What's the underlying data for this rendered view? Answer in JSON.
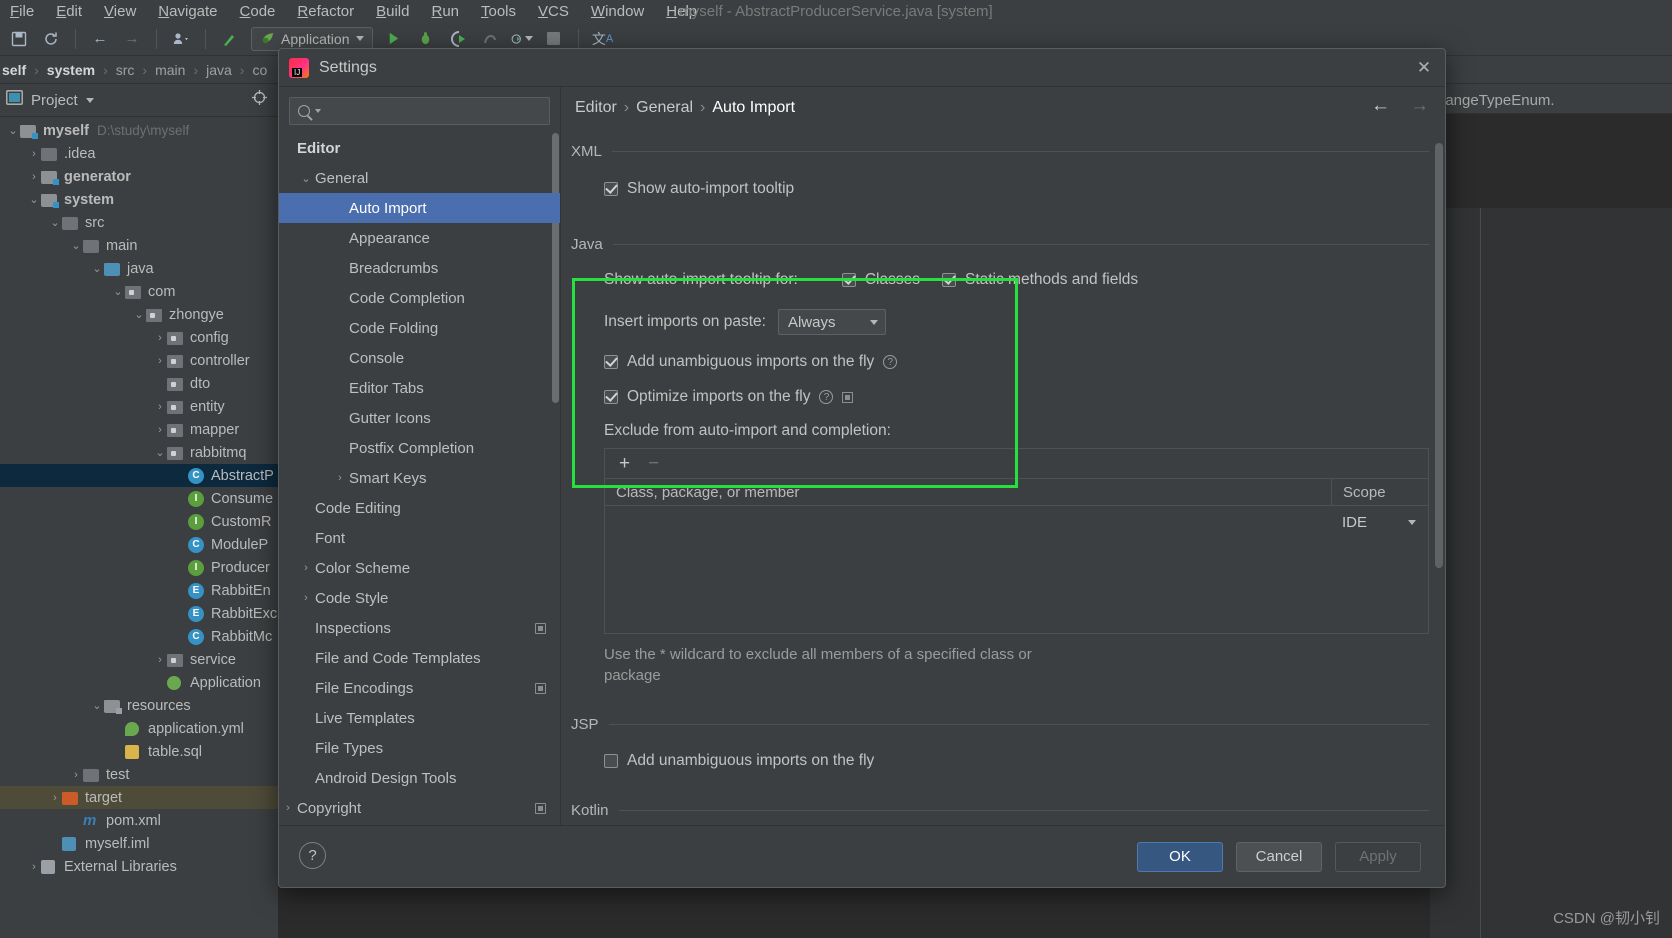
{
  "ide": {
    "window_title": "myself - AbstractProducerService.java [system]",
    "menubar": [
      "File",
      "Edit",
      "View",
      "Navigate",
      "Code",
      "Refactor",
      "Build",
      "Run",
      "Tools",
      "VCS",
      "Window",
      "Help"
    ],
    "toolbar": {
      "run_config": "Application",
      "icons": [
        "save-icon",
        "sync-icon",
        "back-arrow-icon",
        "forward-arrow-icon",
        "profile-icon",
        "build-icon",
        "run-icon",
        "debug-icon",
        "run-coverage-icon",
        "profiler-icon",
        "stop-icon",
        "translate-icon"
      ]
    },
    "breadcrumb": [
      "self",
      "system",
      "src",
      "main",
      "java",
      "co"
    ],
    "editor_tab": "hangeTypeEnum."
  },
  "project_panel": {
    "title": "Project",
    "tree": [
      {
        "indent": 0,
        "arrow": "down",
        "icon": "module-folder",
        "label": "myself",
        "bold": true,
        "path": "D:\\study\\myself"
      },
      {
        "indent": 1,
        "arrow": "right",
        "icon": "folder",
        "label": ".idea",
        "bold": false
      },
      {
        "indent": 1,
        "arrow": "right",
        "icon": "module-folder",
        "label": "generator",
        "bold": true
      },
      {
        "indent": 1,
        "arrow": "down",
        "icon": "module-folder",
        "label": "system",
        "bold": true
      },
      {
        "indent": 2,
        "arrow": "down",
        "icon": "folder",
        "label": "src",
        "bold": false
      },
      {
        "indent": 3,
        "arrow": "down",
        "icon": "folder",
        "label": "main",
        "bold": false
      },
      {
        "indent": 4,
        "arrow": "down",
        "icon": "source-folder",
        "label": "java",
        "bold": false
      },
      {
        "indent": 5,
        "arrow": "down",
        "icon": "package",
        "label": "com",
        "bold": false
      },
      {
        "indent": 6,
        "arrow": "down",
        "icon": "package",
        "label": "zhongye",
        "bold": false
      },
      {
        "indent": 7,
        "arrow": "right",
        "icon": "package",
        "label": "config",
        "bold": false
      },
      {
        "indent": 7,
        "arrow": "right",
        "icon": "package",
        "label": "controller",
        "bold": false
      },
      {
        "indent": 7,
        "arrow": "none",
        "icon": "package",
        "label": "dto",
        "bold": false
      },
      {
        "indent": 7,
        "arrow": "right",
        "icon": "package",
        "label": "entity",
        "bold": false
      },
      {
        "indent": 7,
        "arrow": "right",
        "icon": "package",
        "label": "mapper",
        "bold": false
      },
      {
        "indent": 7,
        "arrow": "down",
        "icon": "package",
        "label": "rabbitmq",
        "bold": false
      },
      {
        "indent": 8,
        "arrow": "none",
        "icon": "class",
        "label": "AbstractP",
        "bold": false,
        "selected": true
      },
      {
        "indent": 8,
        "arrow": "none",
        "icon": "interface",
        "label": "Consume",
        "bold": false
      },
      {
        "indent": 8,
        "arrow": "none",
        "icon": "interface",
        "label": "CustomR",
        "bold": false
      },
      {
        "indent": 8,
        "arrow": "none",
        "icon": "class",
        "label": "ModuleP",
        "bold": false
      },
      {
        "indent": 8,
        "arrow": "none",
        "icon": "interface",
        "label": "Producer",
        "bold": false
      },
      {
        "indent": 8,
        "arrow": "none",
        "icon": "enum",
        "label": "RabbitEn",
        "bold": false
      },
      {
        "indent": 8,
        "arrow": "none",
        "icon": "enum",
        "label": "RabbitExc",
        "bold": false
      },
      {
        "indent": 8,
        "arrow": "none",
        "icon": "class",
        "label": "RabbitMc",
        "bold": false
      },
      {
        "indent": 7,
        "arrow": "right",
        "icon": "package",
        "label": "service",
        "bold": false
      },
      {
        "indent": 7,
        "arrow": "none",
        "icon": "spring",
        "label": "Application",
        "bold": false
      },
      {
        "indent": 4,
        "arrow": "down",
        "icon": "resource-folder",
        "label": "resources",
        "bold": false
      },
      {
        "indent": 5,
        "arrow": "none",
        "icon": "yml",
        "label": "application.yml",
        "bold": false
      },
      {
        "indent": 5,
        "arrow": "none",
        "icon": "sql",
        "label": "table.sql",
        "bold": false
      },
      {
        "indent": 3,
        "arrow": "right",
        "icon": "folder",
        "label": "test",
        "bold": false
      },
      {
        "indent": 2,
        "arrow": "right",
        "icon": "excluded-folder",
        "label": "target",
        "bold": false,
        "highlighted": true
      },
      {
        "indent": 3,
        "arrow": "none",
        "icon": "maven",
        "label": "pom.xml",
        "bold": false
      },
      {
        "indent": 2,
        "arrow": "none",
        "icon": "iml",
        "label": "myself.iml",
        "bold": false
      },
      {
        "indent": 1,
        "arrow": "right",
        "icon": "library",
        "label": "External Libraries",
        "bold": false
      }
    ]
  },
  "settings_dialog": {
    "title": "Settings",
    "close_icon": "close-icon",
    "search": {
      "placeholder": "",
      "value": "",
      "icon": "search-icon"
    },
    "nav": [
      {
        "label": "Editor",
        "level": 0,
        "twisty": "",
        "active": false
      },
      {
        "label": "General",
        "level": 1,
        "twisty": "down",
        "active": false
      },
      {
        "label": "Auto Import",
        "level": 2,
        "twisty": "",
        "active": true
      },
      {
        "label": "Appearance",
        "level": 2,
        "twisty": "",
        "active": false
      },
      {
        "label": "Breadcrumbs",
        "level": 2,
        "twisty": "",
        "active": false
      },
      {
        "label": "Code Completion",
        "level": 2,
        "twisty": "",
        "active": false
      },
      {
        "label": "Code Folding",
        "level": 2,
        "twisty": "",
        "active": false
      },
      {
        "label": "Console",
        "level": 2,
        "twisty": "",
        "active": false
      },
      {
        "label": "Editor Tabs",
        "level": 2,
        "twisty": "",
        "active": false
      },
      {
        "label": "Gutter Icons",
        "level": 2,
        "twisty": "",
        "active": false
      },
      {
        "label": "Postfix Completion",
        "level": 2,
        "twisty": "",
        "active": false
      },
      {
        "label": "Smart Keys",
        "level": 2,
        "twisty": "right",
        "active": false
      },
      {
        "label": "Code Editing",
        "level": 1,
        "twisty": "",
        "active": false
      },
      {
        "label": "Font",
        "level": 1,
        "twisty": "",
        "active": false
      },
      {
        "label": "Color Scheme",
        "level": 1,
        "twisty": "right",
        "active": false
      },
      {
        "label": "Code Style",
        "level": 1,
        "twisty": "right",
        "active": false
      },
      {
        "label": "Inspections",
        "level": 1,
        "twisty": "",
        "active": false,
        "badge": true
      },
      {
        "label": "File and Code Templates",
        "level": 1,
        "twisty": "",
        "active": false
      },
      {
        "label": "File Encodings",
        "level": 1,
        "twisty": "",
        "active": false,
        "badge": true
      },
      {
        "label": "Live Templates",
        "level": 1,
        "twisty": "",
        "active": false
      },
      {
        "label": "File Types",
        "level": 1,
        "twisty": "",
        "active": false
      },
      {
        "label": "Android Design Tools",
        "level": 1,
        "twisty": "",
        "active": false
      },
      {
        "label": "Copyright",
        "level": 0,
        "twisty": "right",
        "active": false,
        "badge": true
      }
    ],
    "breadcrumb": {
      "part1": "Editor",
      "part2": "General",
      "part3": "Auto Import",
      "sep": "›"
    },
    "nav_buttons": {
      "back": "←",
      "forward": "→"
    },
    "sections": {
      "xml": {
        "title": "XML",
        "show_tooltip_label": "Show auto-import tooltip",
        "show_tooltip_checked": true
      },
      "java": {
        "title": "Java",
        "tooltip_for_label": "Show auto-import tooltip for:",
        "classes_label": "Classes",
        "classes_checked": true,
        "static_label": "Static methods and fields",
        "static_checked": true,
        "insert_paste_label": "Insert imports on paste:",
        "insert_paste_value": "Always",
        "add_unambiguous_label": "Add unambiguous imports on the fly",
        "add_unambiguous_checked": true,
        "optimize_label": "Optimize imports on the fly",
        "optimize_checked": true,
        "exclude_label": "Exclude from auto-import and completion:",
        "table": {
          "add_icon": "+",
          "remove_icon": "−",
          "columns": [
            "Class, package, or member",
            "Scope"
          ],
          "rows": [],
          "scope_value": "IDE"
        },
        "hint": "Use the * wildcard to exclude all members of a specified class or package"
      },
      "jsp": {
        "title": "JSP",
        "add_unambiguous_label": "Add unambiguous imports on the fly",
        "add_unambiguous_checked": false
      },
      "kotlin": {
        "title": "Kotlin"
      }
    },
    "footer": {
      "help_label": "?",
      "ok_label": "OK",
      "cancel_label": "Cancel",
      "apply_label": "Apply"
    }
  },
  "watermark": "CSDN @韧小钊",
  "colors": {
    "accent_blue": "#4b6eaf",
    "primary_button": "#365880",
    "annotation_green": "#27e03f",
    "panel_bg": "#3c3f41",
    "editor_bg": "#2b2b2b"
  }
}
